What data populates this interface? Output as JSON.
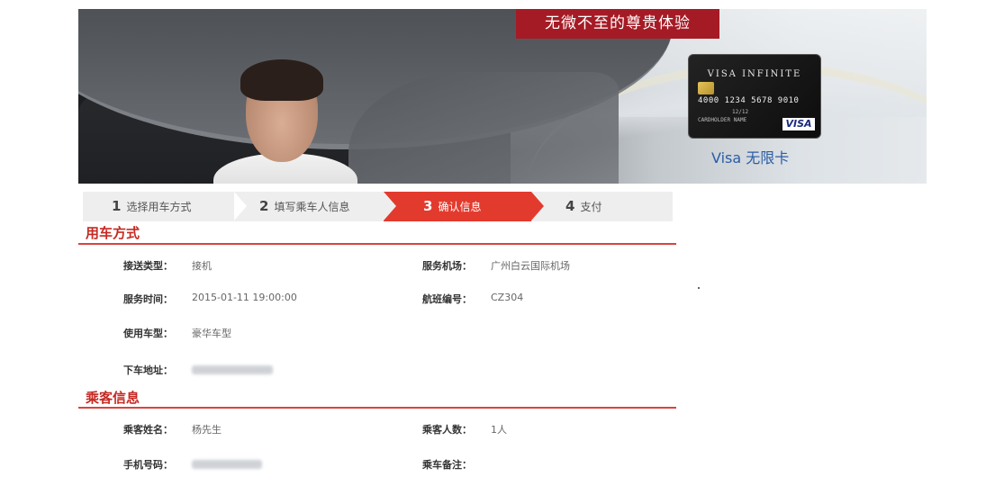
{
  "banner": {
    "tagline": "无微不至的尊贵体验",
    "card": {
      "brand": "VISA INFINITE",
      "number": "4000 1234 5678 9010",
      "expiry": "12/12",
      "holder": "CARDHOLDER NAME",
      "logo": "VISA"
    },
    "card_caption": "Visa 无限卡"
  },
  "steps": [
    {
      "num": "1",
      "label": "选择用车方式"
    },
    {
      "num": "2",
      "label": "填写乘车人信息"
    },
    {
      "num": "3",
      "label": "确认信息"
    },
    {
      "num": "4",
      "label": "支付"
    }
  ],
  "active_step": 3,
  "car_usage": {
    "title": "用车方式",
    "transfer_type_label": "接送类型：",
    "transfer_type_value": "接机",
    "airport_label": "服务机场：",
    "airport_value": "广州白云国际机场",
    "service_time_label": "服务时间：",
    "service_time_value": "2015-01-11 19:00:00",
    "flight_label": "航班编号：",
    "flight_value": "CZ304",
    "vehicle_label": "使用车型：",
    "vehicle_value": "豪华车型",
    "dropoff_label": "下车地址："
  },
  "passenger": {
    "title": "乘客信息",
    "name_label": "乘客姓名：",
    "name_value": "杨先生",
    "count_label": "乘客人数：",
    "count_value": "1人",
    "phone_label": "手机号码：",
    "notes_label": "乘车备注："
  },
  "colors": {
    "accent_red": "#e33a2e",
    "tagline_red": "#a51b25",
    "caption_blue": "#2b5ca5"
  }
}
